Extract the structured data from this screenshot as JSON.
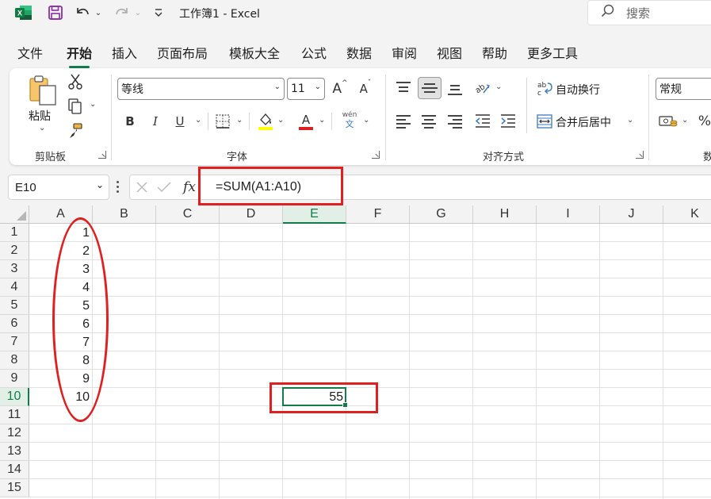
{
  "titlebar": {
    "title": "工作簿1  -  Excel",
    "search_placeholder": "搜索",
    "icons": [
      "excel-logo-icon",
      "save-icon",
      "undo-icon",
      "redo-icon",
      "customize-qat-icon",
      "search-icon"
    ]
  },
  "menu": {
    "tabs": [
      "文件",
      "开始",
      "插入",
      "页面布局",
      "模板大全",
      "公式",
      "数据",
      "审阅",
      "视图",
      "帮助",
      "更多工具"
    ],
    "active": "开始"
  },
  "ribbon": {
    "clipboard": {
      "paste_label": "粘贴",
      "group_label": "剪贴板"
    },
    "font": {
      "font_name": "等线",
      "font_size": "11",
      "bold": "B",
      "italic": "I",
      "underline": "U",
      "grow_font": "A",
      "shrink_font": "A",
      "phonetic_top": "wén",
      "phonetic_bottom": "文",
      "font_color_letter": "A",
      "group_label": "字体"
    },
    "alignment": {
      "wrap_text": "自动换行",
      "merge_center": "合并后居中",
      "group_label": "对齐方式"
    },
    "number": {
      "format": "常规",
      "percent": "%",
      "group_label_partial": "数"
    },
    "colors": {
      "fill": "#ffff00",
      "font": "#e02020"
    }
  },
  "formula_bar": {
    "name_box": "E10",
    "fx": "fx",
    "formula": "=SUM(A1:A10)"
  },
  "sheet": {
    "columns": [
      "A",
      "B",
      "C",
      "D",
      "E",
      "F",
      "G",
      "H",
      "I",
      "J",
      "K"
    ],
    "rows": [
      "1",
      "2",
      "3",
      "4",
      "5",
      "6",
      "7",
      "8",
      "9",
      "10",
      "11",
      "12",
      "13",
      "14",
      "15"
    ],
    "selected_column": "E",
    "selected_row": "10",
    "column_a_values": [
      "1",
      "2",
      "3",
      "4",
      "5",
      "6",
      "7",
      "8",
      "9",
      "10"
    ],
    "result_cell": "E10",
    "result_value": "55"
  },
  "accent_color": "#117e4a",
  "annotation_color": "#e02020"
}
